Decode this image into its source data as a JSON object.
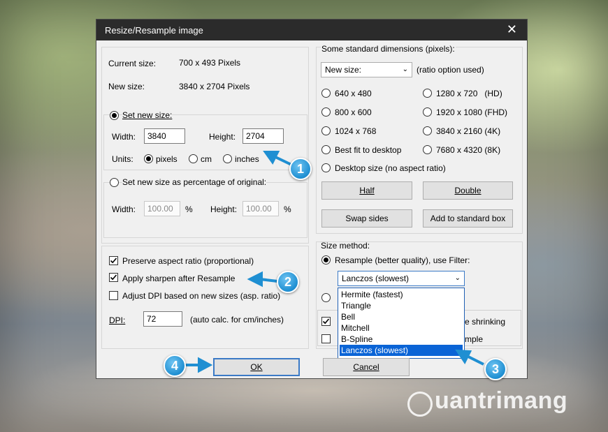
{
  "window": {
    "title": "Resize/Resample image",
    "close_glyph": "✕"
  },
  "size_info": {
    "current_label": "Current size:",
    "current_value": "700  x  493  Pixels",
    "new_label": "New size:",
    "new_value": "3840  x  2704  Pixels"
  },
  "set_new_size": {
    "label": "Set new size:",
    "width_label": "Width:",
    "width_value": "3840",
    "height_label": "Height:",
    "height_value": "2704",
    "units_label": "Units:",
    "unit_options": [
      "pixels",
      "cm",
      "inches"
    ],
    "selected_unit": "pixels"
  },
  "percentage": {
    "label": "Set new size as percentage of original:",
    "width_label": "Width:",
    "width_value": "100.00",
    "width_unit": "%",
    "height_label": "Height:",
    "height_value": "100.00",
    "height_unit": "%"
  },
  "options": {
    "preserve_aspect": {
      "label": "Preserve aspect ratio (proportional)",
      "checked": true
    },
    "apply_sharpen": {
      "label": "Apply sharpen after Resample",
      "checked": true
    },
    "adjust_dpi": {
      "label": "Adjust DPI based on new sizes (asp. ratio)",
      "checked": false
    },
    "dpi_label": "DPI:",
    "dpi_value": "72",
    "dpi_note": "(auto calc. for cm/inches)"
  },
  "standard_dims": {
    "group_label": "Some standard dimensions (pixels):",
    "select_value": "New size:",
    "ratio_note": "(ratio option used)",
    "left_options": [
      "640 x 480",
      "800 x 600",
      "1024 x 768",
      "Best fit to desktop"
    ],
    "right_options": [
      "1280 x 720   (HD)",
      "1920 x 1080 (FHD)",
      "3840 x 2160 (4K)",
      "7680 x 4320 (8K)"
    ],
    "desktop_option": "Desktop size (no aspect ratio)",
    "half_button": "Half",
    "double_button": "Double",
    "swap_button": "Swap sides",
    "add_button": "Add to standard box"
  },
  "size_method": {
    "group_label": "Size method:",
    "resample_label": "Resample (better quality), use Filter:",
    "filter_value": "Lanczos (slowest)",
    "filter_options": [
      "Hermite (fastest)",
      "Triangle",
      "Bell",
      "Mitchell",
      "B-Spline",
      "Lanczos (slowest)"
    ],
    "partial_text_1": "e shrinking",
    "partial_text_2": "mple"
  },
  "buttons": {
    "ok": "OK",
    "cancel": "Cancel"
  },
  "callouts": [
    "1",
    "2",
    "3",
    "4"
  ],
  "watermark": "uantrimang",
  "colors": {
    "titlebar": "#2b2b2b",
    "dialog_bg": "#f0f0f0",
    "selection": "#0a64d6",
    "callout": "#1f8fd2",
    "default_button_border": "#3b7ac6"
  }
}
